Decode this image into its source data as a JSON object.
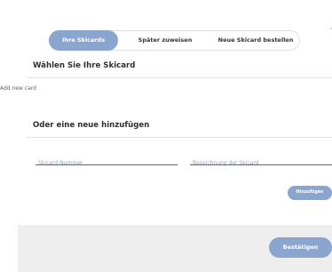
{
  "tabs": [
    {
      "label": "Ihre Skicards",
      "active": true
    },
    {
      "label": "Später zuweisen",
      "active": false
    },
    {
      "label": "Neue Skicard bestellen",
      "active": false
    }
  ],
  "my_cards": {
    "title": "Wählen Sie Ihre Skicard",
    "add_new_card": "Add new card"
  },
  "add_form": {
    "title": "Oder eine neue hinzufügen",
    "number_placeholder": "Skicard-Nummer",
    "name_placeholder": "Bezeichnung der Skicard",
    "add_button": "Hinzufügen"
  },
  "footer": {
    "confirm_button": "Bestätigen"
  },
  "colors": {
    "accent": "#8ba5cf",
    "footer_background": "#eeeeee"
  }
}
